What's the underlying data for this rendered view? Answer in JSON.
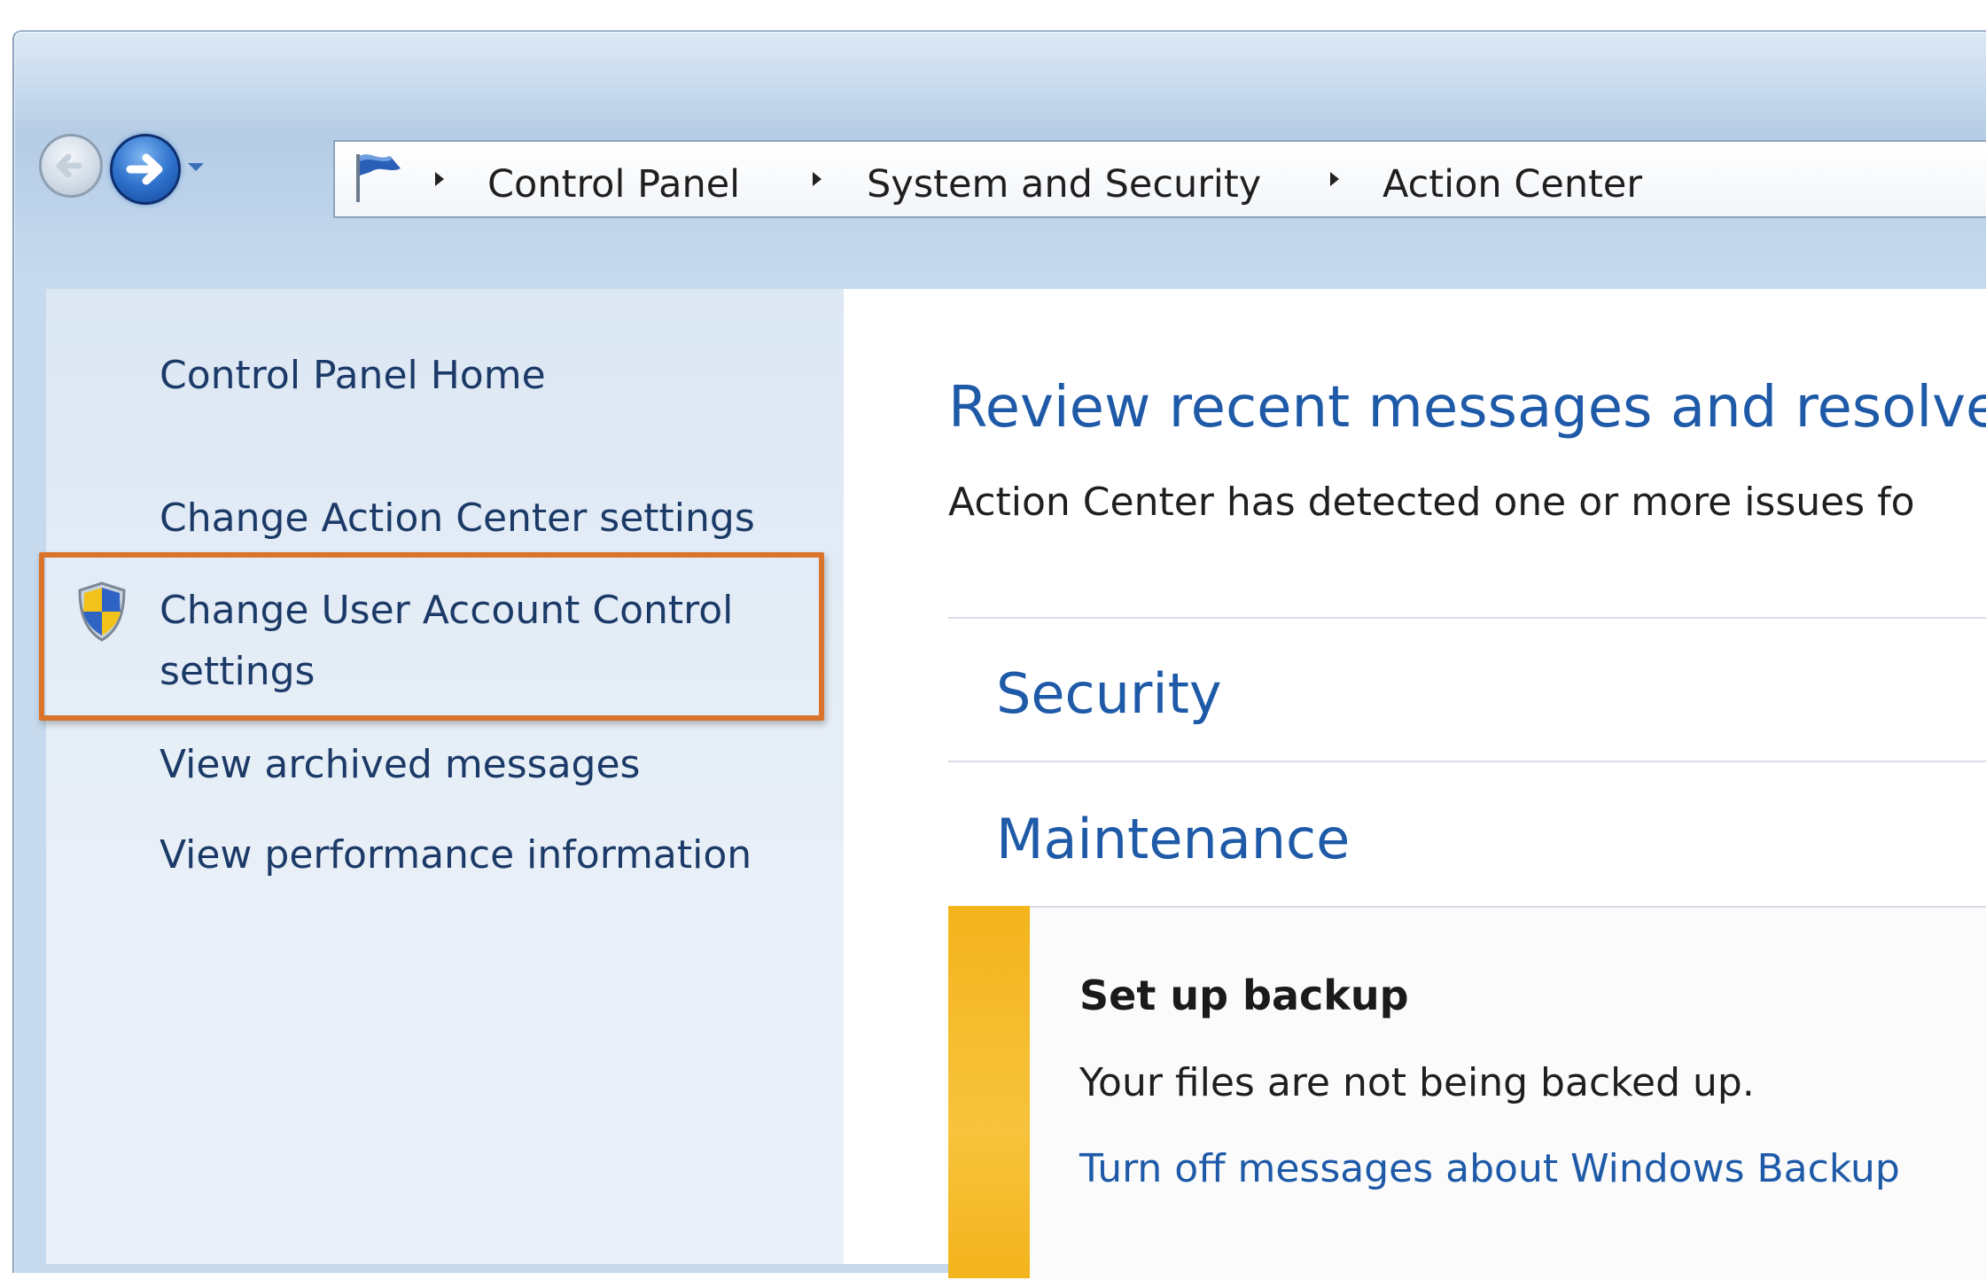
{
  "breadcrumb": {
    "items": [
      "Control Panel",
      "System and Security",
      "Action Center"
    ]
  },
  "icons": {
    "back": "arrow-left-icon",
    "forward": "arrow-right-icon",
    "dropdown": "chevron-down-icon",
    "location": "action-center-flag-icon",
    "uac": "uac-shield-icon",
    "separator": "chevron-right-icon"
  },
  "sidebar": {
    "items": [
      {
        "label": "Control Panel Home"
      },
      {
        "label": "Change Action Center settings"
      },
      {
        "label": "Change User Account Control"
      },
      {
        "label": "settings"
      },
      {
        "label": "View archived messages"
      },
      {
        "label": "View performance information"
      }
    ]
  },
  "main": {
    "heading": "Review recent messages and resolve p",
    "description": "Action Center has detected one or more issues fo",
    "sections": [
      {
        "title": "Security"
      },
      {
        "title": "Maintenance"
      }
    ],
    "alert": {
      "title": "Set up backup",
      "description": "Your files are not being backed up.",
      "link": "Turn off messages about Windows Backup"
    }
  },
  "colors": {
    "link": "#1e5aa8",
    "highlight": "#d9742a",
    "alert_bar": "#f3b41c"
  }
}
